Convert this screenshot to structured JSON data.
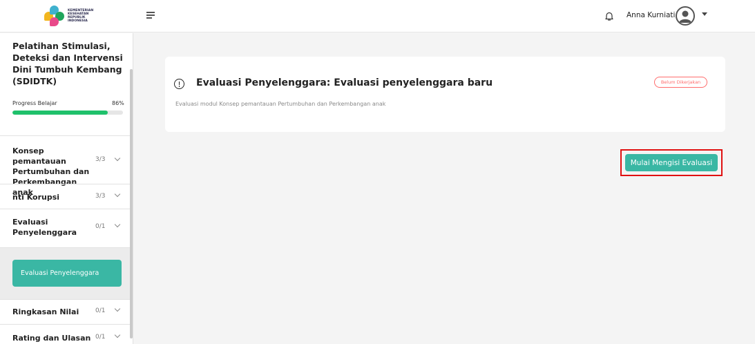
{
  "header": {
    "logo_text": [
      "KEMENTERIAN",
      "KESEHATAN",
      "REPUBLIK",
      "INDONESIA"
    ],
    "user_name": "Anna Kurniati, S ...",
    "icons": {
      "menu": "hamburger-menu-icon",
      "notifications": "bell-icon",
      "avatar": "user-avatar-icon",
      "dropdown": "caret-down-icon"
    }
  },
  "sidebar": {
    "course_title": "Pelatihan Stimulasi, Deteksi dan Intervensi Dini Tumbuh Kembang (SDIDTK)",
    "progress": {
      "label": "Progress Belajar",
      "percent_text": "86%",
      "value": 0.86,
      "color": "#1fc16b"
    },
    "modules": [
      {
        "name": "Konsep pemantauan Pertumbuhan dan Perkembangan anak",
        "count": "3/3"
      },
      {
        "name": "nti Korupsi",
        "count": "3/3"
      },
      {
        "name": "Evaluasi Penyelenggara",
        "count": "0/1",
        "selected": true
      },
      {
        "name": "Ringkasan Nilai",
        "count": "0/1"
      },
      {
        "name": "Rating dan Ulasan",
        "count": "0/1"
      }
    ],
    "active_sub_item": "Evaluasi Penyelenggara"
  },
  "main": {
    "card": {
      "title": "Evaluasi Penyelenggara: Evaluasi penyelenggara baru",
      "description": "Evaluasi modul Konsep pemantauan Pertumbuhan dan Perkembangan anak",
      "status": "Belum Dikerjakan",
      "icon": "exclamation-circle-icon"
    },
    "start_button": "Mulai Mengisi Evaluasi"
  },
  "colors": {
    "accent": "#3ab7a4",
    "status": "#ff6b6b",
    "highlight_box": "#e01010"
  }
}
